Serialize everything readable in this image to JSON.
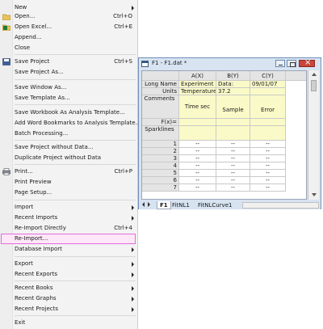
{
  "menu": {
    "items": [
      {
        "label": "New",
        "shortcut": "",
        "submenu": true
      },
      {
        "label": "Open...",
        "shortcut": "Ctrl+O",
        "submenu": false,
        "icon": "open-folder-icon"
      },
      {
        "label": "Open Excel...",
        "shortcut": "Ctrl+E",
        "submenu": false,
        "icon": "excel-icon"
      },
      {
        "label": "Append...",
        "shortcut": "",
        "submenu": false
      },
      {
        "label": "Close",
        "shortcut": "",
        "submenu": false
      },
      {
        "label": "Save Project",
        "shortcut": "Ctrl+S",
        "submenu": false,
        "icon": "save-icon"
      },
      {
        "label": "Save Project As...",
        "shortcut": "",
        "submenu": false
      },
      {
        "label": "Save Window As...",
        "shortcut": "",
        "submenu": false
      },
      {
        "label": "Save Template As...",
        "shortcut": "",
        "submenu": false
      },
      {
        "label": "Save Workbook As Analysis Template...",
        "shortcut": "",
        "submenu": false
      },
      {
        "label": "Add Word Bookmarks to Analysis Template...",
        "shortcut": "",
        "submenu": false
      },
      {
        "label": "Batch Processing...",
        "shortcut": "",
        "submenu": false
      },
      {
        "label": "Save Project without Data...",
        "shortcut": "",
        "submenu": false
      },
      {
        "label": "Duplicate Project without Data",
        "shortcut": "",
        "submenu": false
      },
      {
        "label": "Print...",
        "shortcut": "Ctrl+P",
        "submenu": false,
        "icon": "print-icon"
      },
      {
        "label": "Print Preview",
        "shortcut": "",
        "submenu": false
      },
      {
        "label": "Page Setup...",
        "shortcut": "",
        "submenu": false
      },
      {
        "label": "Import",
        "shortcut": "",
        "submenu": true
      },
      {
        "label": "Recent Imports",
        "shortcut": "",
        "submenu": true
      },
      {
        "label": "Re-Import Directly",
        "shortcut": "Ctrl+4",
        "submenu": false
      },
      {
        "label": "Re-Import...",
        "shortcut": "",
        "submenu": false,
        "highlighted": true
      },
      {
        "label": "Database Import",
        "shortcut": "",
        "submenu": true
      },
      {
        "label": "Export",
        "shortcut": "",
        "submenu": true
      },
      {
        "label": "Recent Exports",
        "shortcut": "",
        "submenu": true
      },
      {
        "label": "Recent Books",
        "shortcut": "",
        "submenu": true
      },
      {
        "label": "Recent Graphs",
        "shortcut": "",
        "submenu": true
      },
      {
        "label": "Recent Projects",
        "shortcut": "",
        "submenu": true
      },
      {
        "label": "Exit",
        "shortcut": "",
        "submenu": false
      }
    ]
  },
  "workbook": {
    "title": "F1 - F1.dat *",
    "columns": [
      {
        "header": "A(X)",
        "long_name": "Experiment",
        "units": "Temperature:",
        "comments": "Time sec",
        "cells": [
          "--",
          "--",
          "--",
          "--",
          "--",
          "--",
          "--"
        ]
      },
      {
        "header": "B(Y)",
        "long_name": "Data:",
        "units": "37.2",
        "comments": "Sample",
        "cells": [
          "--",
          "--",
          "--",
          "--",
          "--",
          "--",
          "--"
        ]
      },
      {
        "header": "C(Y)",
        "long_name": "09/01/07",
        "units": "",
        "comments": "Error",
        "cells": [
          "--",
          "--",
          "--",
          "--",
          "--",
          "--",
          "--"
        ]
      }
    ],
    "row_labels": {
      "long_name": "Long Name",
      "units": "Units",
      "comments": "Comments",
      "fx": "F(x)=",
      "sparklines": "Sparklines"
    },
    "rows": [
      "1",
      "2",
      "3",
      "4",
      "5",
      "6",
      "7"
    ],
    "tabs": [
      "F1",
      "FitNL1",
      "FitNLCurve1"
    ],
    "active_tab": "F1"
  },
  "colors": {
    "highlight_border": "#e36bdc",
    "meta_rows": "#fafac8",
    "window_frame": "#d7e3f1"
  }
}
